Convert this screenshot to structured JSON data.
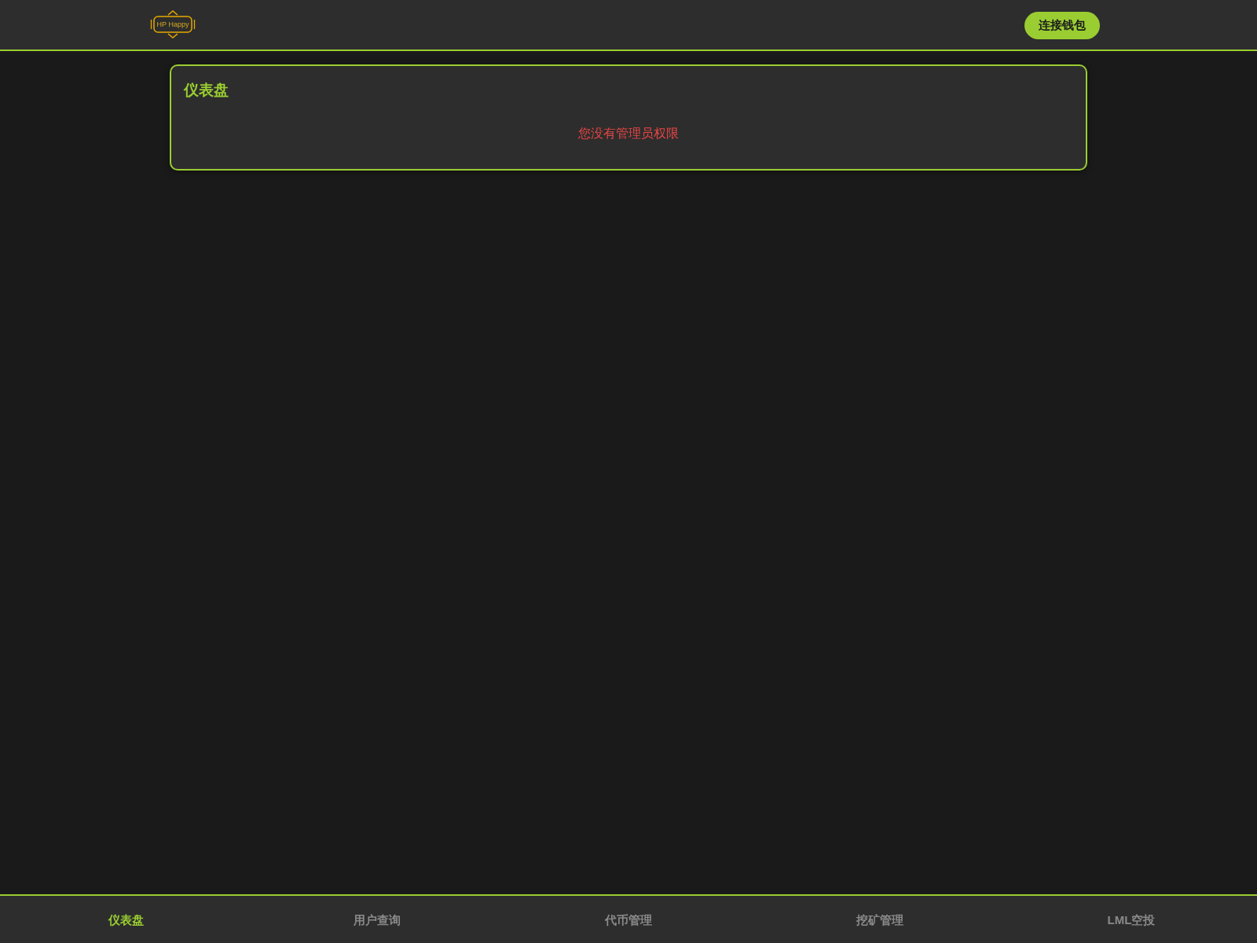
{
  "header": {
    "logo": {
      "text": "HP Happy"
    },
    "connect_button": "连接钱包"
  },
  "card": {
    "title": "仪表盘",
    "message": "您没有管理员权限"
  },
  "bottom_nav": [
    {
      "label": "仪表盘",
      "selected": true
    },
    {
      "label": "用户查询",
      "selected": false
    },
    {
      "label": "代币管理",
      "selected": false
    },
    {
      "label": "挖矿管理",
      "selected": false
    },
    {
      "label": "LML空投",
      "selected": false
    }
  ]
}
